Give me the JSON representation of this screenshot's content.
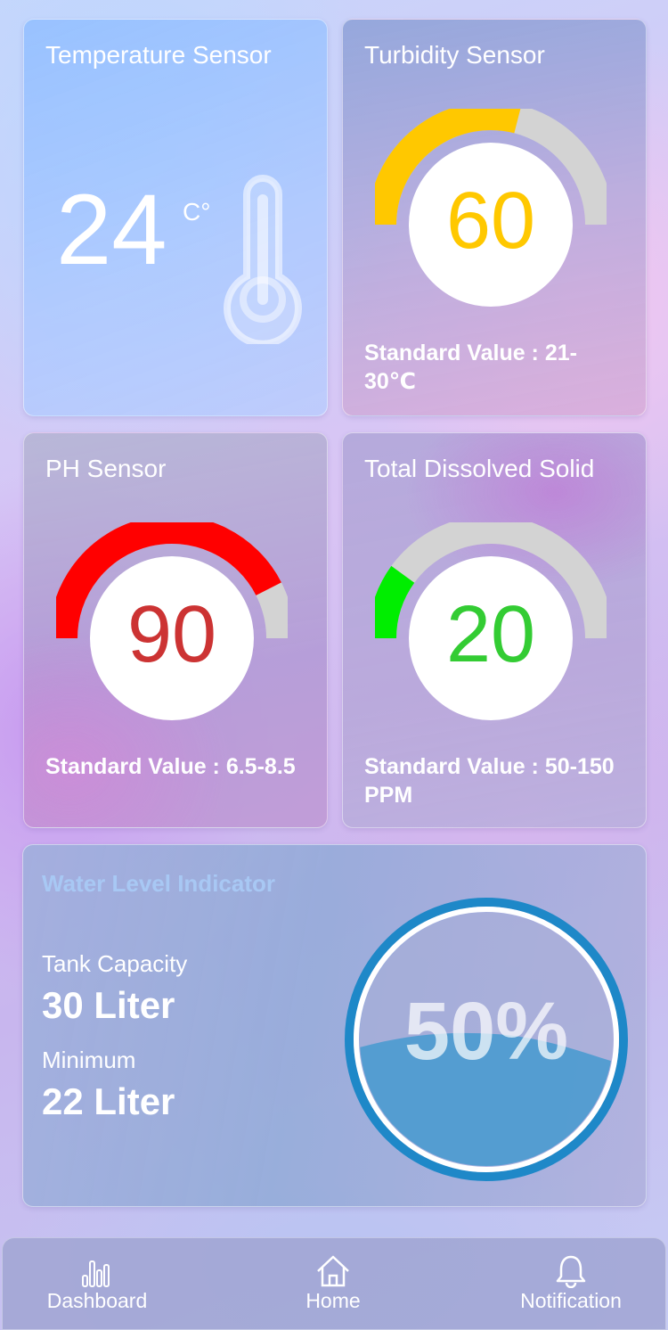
{
  "temperature": {
    "title": "Temperature Sensor",
    "value": "24",
    "unit": "C°",
    "icon": "thermometer-icon"
  },
  "turbidity": {
    "title": "Turbidity Sensor",
    "value": "60",
    "level": 0.58,
    "color": "#ffc800",
    "standard": "Standard Value : 21-30℃"
  },
  "ph": {
    "title": "PH Sensor",
    "value": "90",
    "level": 0.85,
    "color": "#ff0000",
    "value_color": "#cc3333",
    "standard": "Standard Value : 6.5-8.5"
  },
  "tds": {
    "title": "Total Dissolved Solid",
    "value": "20",
    "level": 0.2,
    "color": "#00ee00",
    "value_color": "#33cc33",
    "standard": "Standard Value : 50-150 PPM"
  },
  "water": {
    "title": "Water Level Indicator",
    "capacity_label": "Tank Capacity",
    "capacity_value": "30 Liter",
    "minimum_label": "Minimum",
    "minimum_value": "22 Liter",
    "percent": "50%",
    "level": 0.5
  },
  "nav": {
    "items": [
      {
        "label": "Dashboard",
        "icon": "bar-chart-icon"
      },
      {
        "label": "Home",
        "icon": "home-icon"
      },
      {
        "label": "Notification",
        "icon": "bell-icon"
      }
    ]
  },
  "colors": {
    "gauge_track": "#d3d3d3",
    "water_ring": "#1e88c8",
    "water_fill": "#4d9bd0"
  }
}
